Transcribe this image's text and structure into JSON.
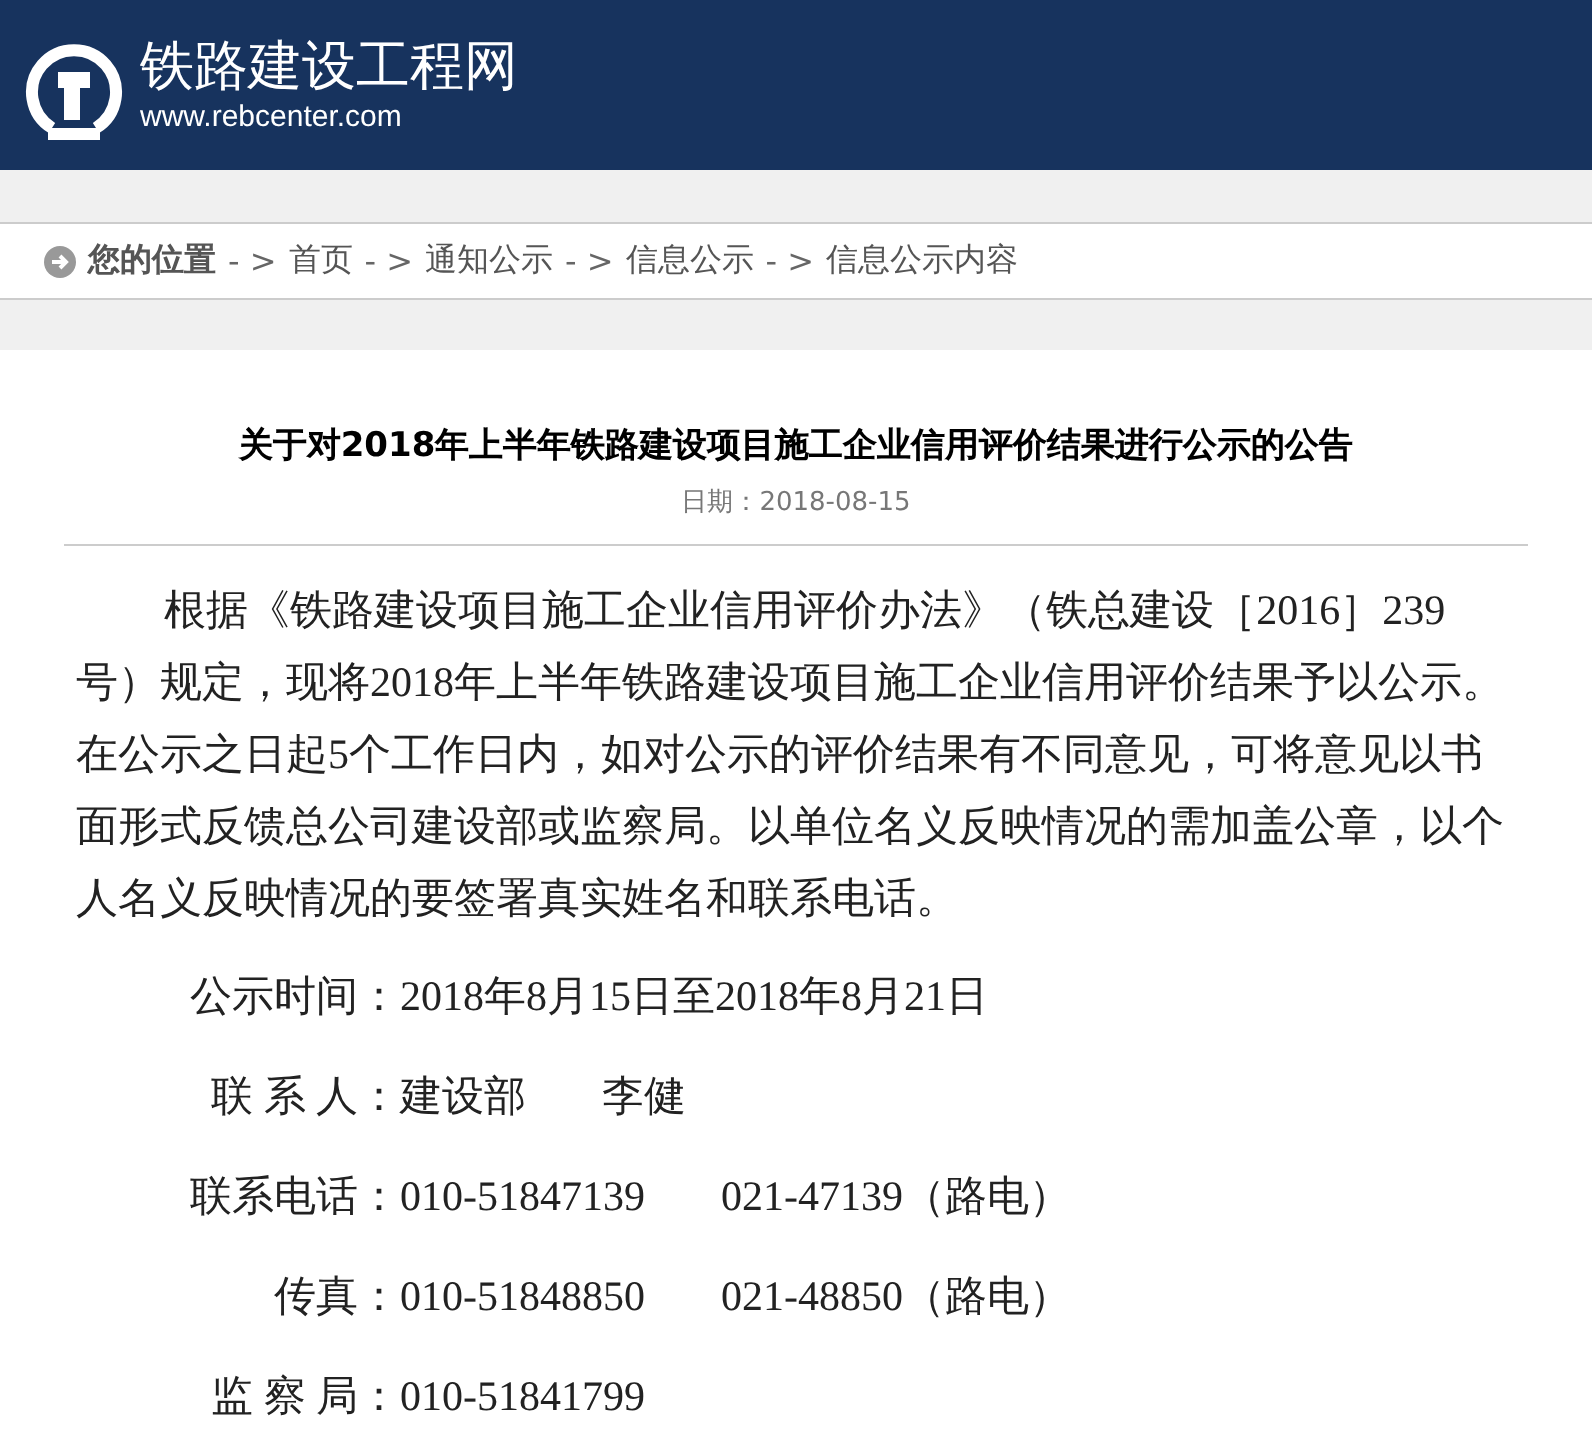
{
  "header": {
    "site_name": "铁路建设工程网",
    "site_url": "www.rebcenter.com"
  },
  "breadcrumb": {
    "items": [
      "您的位置",
      "首页",
      "通知公示",
      "信息公示",
      "信息公示内容"
    ],
    "separator": "- >"
  },
  "article": {
    "title": "关于对2018年上半年铁路建设项目施工企业信用评价结果进行公示的公告",
    "date": "日期：2018-08-15",
    "paragraph": "根据《铁路建设项目施工企业信用评价办法》（铁总建设［2016］239号）规定，现将2018年上半年铁路建设项目施工企业信用评价结果予以公示。在公示之日起5个工作日内，如对公示的评价结果有不同意见，可将意见以书面形式反馈总公司建设部或监察局。以单位名义反映情况的需加盖公章，以个人名义反映情况的要签署真实姓名和联系电话。",
    "details": [
      {
        "label": "公示时间：",
        "values": [
          "2018年8月15日至2018年8月21日"
        ]
      },
      {
        "label": "联 系 人：",
        "values": [
          "建设部",
          "李健"
        ]
      },
      {
        "label": "联系电话：",
        "values": [
          "010-51847139",
          "021-47139（路电）"
        ]
      },
      {
        "label": "传真：",
        "values": [
          "010-51848850",
          "021-48850（路电）"
        ]
      },
      {
        "label": "监 察 局：",
        "values": [
          "010-51841799"
        ]
      }
    ]
  }
}
